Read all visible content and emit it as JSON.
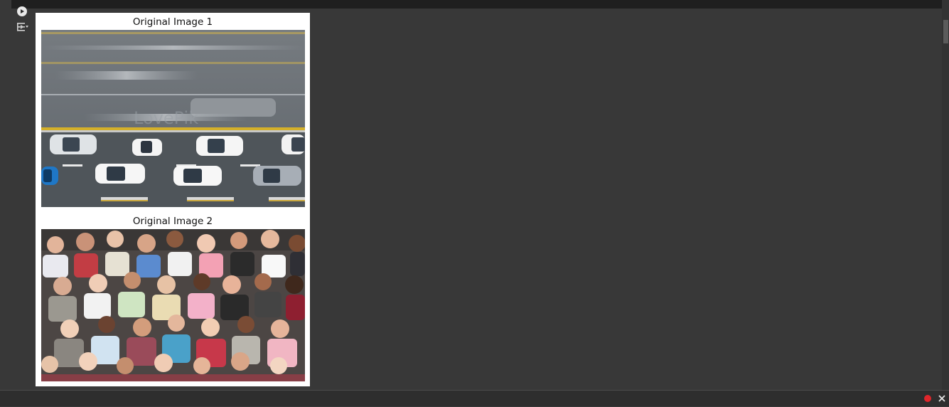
{
  "notebook": {
    "run_icon": "play-icon",
    "output_icon": "output-toggle-icon"
  },
  "figure": {
    "captions": [
      "Original Image 1",
      "Original Image 2"
    ],
    "image1": {
      "subject": "aerial view of cars on a road",
      "watermark": "LovePik"
    },
    "image2": {
      "subject": "aerial view of a crowd of people"
    }
  },
  "statusbar": {
    "record_icon": "record-dot-icon",
    "close_icon": "close-icon",
    "record_color": "#e0262b"
  }
}
